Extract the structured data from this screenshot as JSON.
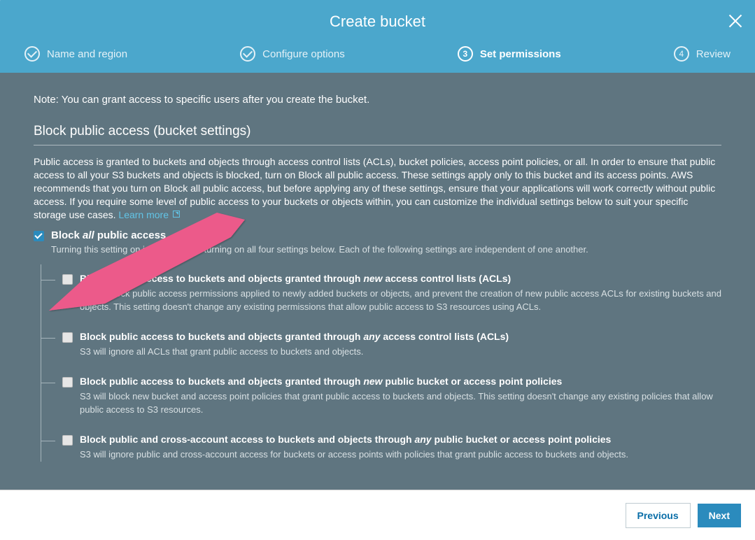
{
  "title": "Create bucket",
  "steps": [
    {
      "label": "Name and region",
      "type": "check"
    },
    {
      "label": "Configure options",
      "type": "check"
    },
    {
      "label": "Set permissions",
      "type": "num",
      "num": "3"
    },
    {
      "label": "Review",
      "type": "num",
      "num": "4"
    }
  ],
  "note": "Note: You can grant access to specific users after you create the bucket.",
  "section_title": "Block public access (bucket settings)",
  "description": "Public access is granted to buckets and objects through access control lists (ACLs), bucket policies, access point policies, or all. In order to ensure that public access to all your S3 buckets and objects is blocked, turn on Block all public access. These settings apply only to this bucket and its access points. AWS recommends that you turn on Block all public access, but before applying any of these settings, ensure that your applications will work correctly without public access. If you require some level of public access to your buckets or objects within, you can customize the individual settings below to suit your specific storage use cases. ",
  "learn_more": "Learn more",
  "block_all": {
    "prefix": "Block ",
    "ital": "all",
    "suffix": " public access",
    "desc": "Turning this setting on is the same as turning on all four settings below. Each of the following settings are independent of one another."
  },
  "subs": [
    {
      "t1": "Block public access to buckets and objects granted through ",
      "it": "new",
      "t2": " access control lists (ACLs)",
      "desc": "S3 will block public access permissions applied to newly added buckets or objects, and prevent the creation of new public access ACLs for existing buckets and objects. This setting doesn't change any existing permissions that allow public access to S3 resources using ACLs."
    },
    {
      "t1": "Block public access to buckets and objects granted through ",
      "it": "any",
      "t2": " access control lists (ACLs)",
      "desc": "S3 will ignore all ACLs that grant public access to buckets and objects."
    },
    {
      "t1": "Block public access to buckets and objects granted through ",
      "it": "new",
      "t2": " public bucket or access point policies",
      "desc": "S3 will block new bucket and access point policies that grant public access to buckets and objects. This setting doesn't change any existing policies that allow public access to S3 resources."
    },
    {
      "t1": "Block public and cross-account access to buckets and objects through ",
      "it": "any",
      "t2": " public bucket or access point policies",
      "desc": "S3 will ignore public and cross-account access for buckets or access points with policies that grant public access to buckets and objects."
    }
  ],
  "footer": {
    "prev": "Previous",
    "next": "Next"
  }
}
